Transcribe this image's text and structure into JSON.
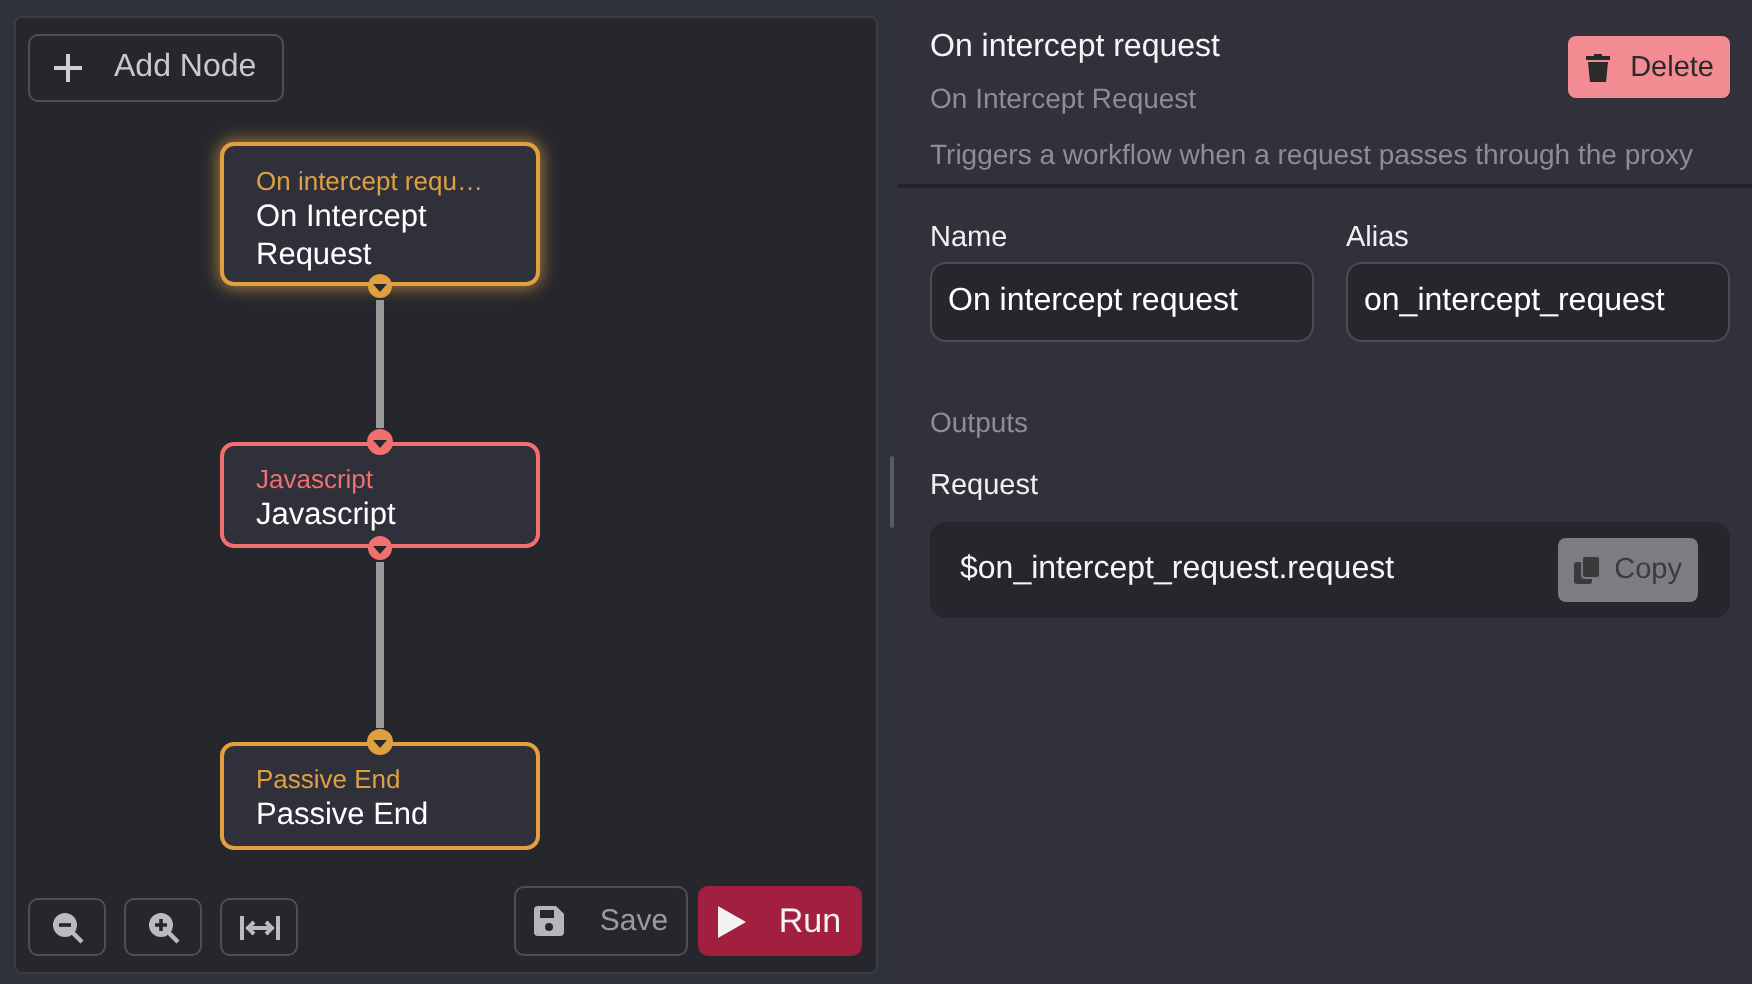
{
  "canvas": {
    "add_button": "Add Node",
    "nodes": [
      {
        "subtitle": "On intercept requ…",
        "title": "On Intercept Request",
        "color": "#e0a040",
        "selected": true
      },
      {
        "subtitle": "Javascript",
        "title": "Javascript",
        "color": "#f07070",
        "selected": false
      },
      {
        "subtitle": "Passive End",
        "title": "Passive End",
        "color": "#e0a040",
        "selected": false
      }
    ],
    "save_button": "Save",
    "run_button": "Run"
  },
  "details": {
    "title": "On intercept request",
    "subtitle": "On Intercept Request",
    "description": "Triggers a workflow when a request passes through the proxy",
    "delete_button": "Delete",
    "fields": [
      {
        "label": "Name",
        "value": "On intercept request"
      },
      {
        "label": "Alias",
        "value": "on_intercept_request"
      }
    ],
    "outputs_heading": "Outputs",
    "outputs": [
      {
        "label": "Request",
        "value": "$on_intercept_request.request",
        "copy_button": "Copy"
      }
    ]
  }
}
